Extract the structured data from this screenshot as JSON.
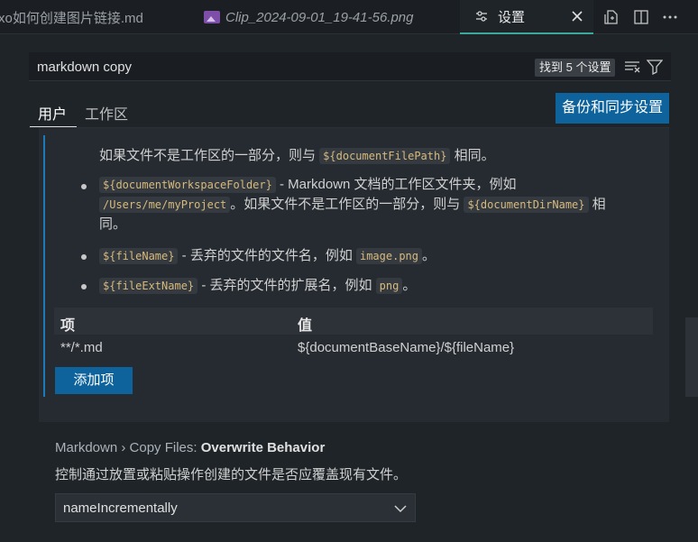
{
  "tabs": [
    {
      "label": "xo如何创建图片链接.md"
    },
    {
      "label": "Clip_2024-09-01_19-41-56.png"
    },
    {
      "label": "设置"
    }
  ],
  "search": {
    "value": "markdown copy",
    "result_badge": "找到 5 个设置"
  },
  "scopes": {
    "user": "用户",
    "workspace": "工作区"
  },
  "sync_button": "备份和同步设置",
  "setting": {
    "line1_pre": "如果文件不是工作区的一部分，则与 ",
    "line1_code": "${documentFilePath}",
    "line1_post": " 相同。",
    "b1_code": "${documentWorkspaceFolder}",
    "b1_text": " - Markdown 文档的工作区文件夹，例如",
    "b1_code2": "/Users/me/myProject",
    "b1_text2": "。如果文件不是工作区的一部分，则与 ",
    "b1_code3": "${documentDirName}",
    "b1_text3": " 相",
    "b1_text4": "同。",
    "b2_code": "${fileName}",
    "b2_text": " - 丢弃的文件的文件名，例如 ",
    "b2_code2": "image.png",
    "b2_text2": "。",
    "b3_code": "${fileExtName}",
    "b3_text": " - 丢弃的文件的扩展名，例如 ",
    "b3_code2": "png",
    "b3_text2": "。",
    "table": {
      "headers": [
        "项",
        "值"
      ],
      "rows": [
        [
          "**/*.md",
          "${documentBaseName}/${fileName}"
        ]
      ]
    },
    "add_button": "添加项"
  },
  "next_setting": {
    "category": "Markdown › Copy Files: ",
    "name": "Overwrite Behavior",
    "description": "控制通过放置或粘贴操作创建的文件是否应覆盖现有文件。",
    "value": "nameIncrementally"
  },
  "colors": {
    "accent_button": "#0e639c",
    "active_tab_border": "#3aa89a",
    "modified_bar": "#1c7ab9"
  },
  "icons": [
    "image-file-icon",
    "settings-icon",
    "close-icon",
    "open-changes-icon",
    "split-editor-icon",
    "more-icon",
    "clear-filter-icon",
    "filter-icon",
    "chevron-down-icon"
  ]
}
